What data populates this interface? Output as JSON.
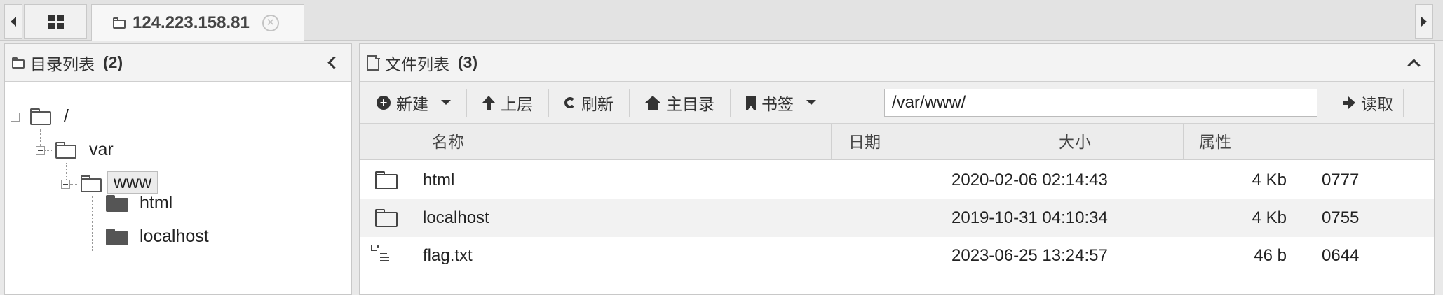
{
  "tabs": {
    "active_label": "124.223.158.81"
  },
  "directory_panel": {
    "title": "目录列表",
    "count": "(2)",
    "tree": {
      "root": "/",
      "var": "var",
      "www": "www",
      "html": "html",
      "localhost": "localhost"
    }
  },
  "file_panel": {
    "title": "文件列表",
    "count": "(3)",
    "toolbar": {
      "new": "新建",
      "up": "上层",
      "refresh": "刷新",
      "home": "主目录",
      "bookmark": "书签",
      "path": "/var/www/",
      "read": "读取"
    },
    "columns": {
      "name": "名称",
      "date": "日期",
      "size": "大小",
      "attr": "属性"
    },
    "rows": [
      {
        "icon": "folder-icon",
        "name": "html",
        "date": "2020-02-06 02:14:43",
        "size": "4 Kb",
        "attr": "0777"
      },
      {
        "icon": "folder-icon",
        "name": "localhost",
        "date": "2019-10-31 04:10:34",
        "size": "4 Kb",
        "attr": "0755"
      },
      {
        "icon": "text-file-icon",
        "name": "flag.txt",
        "date": "2023-06-25 13:24:57",
        "size": "46 b",
        "attr": "0644"
      }
    ]
  }
}
